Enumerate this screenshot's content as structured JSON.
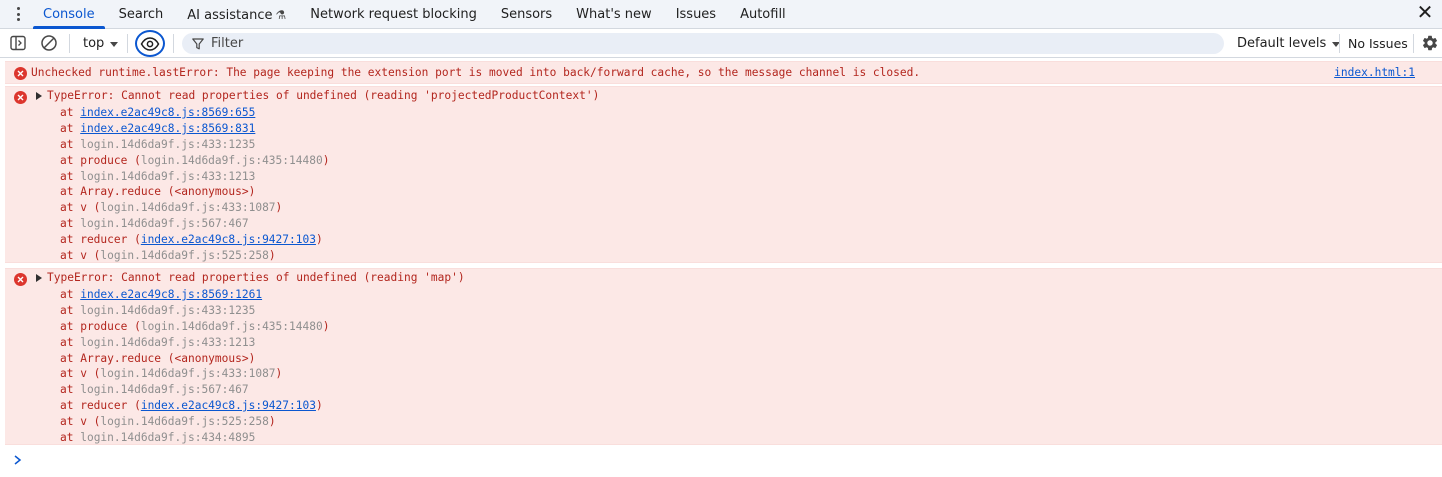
{
  "tabs": [
    {
      "label": "Console",
      "active": true
    },
    {
      "label": "Search"
    },
    {
      "label": "AI assistance",
      "icon": "flask-icon"
    },
    {
      "label": "Network request blocking"
    },
    {
      "label": "Sensors"
    },
    {
      "label": "What's new"
    },
    {
      "label": "Issues"
    },
    {
      "label": "Autofill"
    }
  ],
  "toolbar": {
    "context": "top",
    "filter_placeholder": "Filter",
    "levels": "Default levels",
    "issues": "No Issues"
  },
  "colors": {
    "accent": "#0b57d0",
    "error_bg": "#fce8e6",
    "error_text": "#b3261e",
    "error_icon": "#dc362e"
  },
  "messages": [
    {
      "text": "Unchecked runtime.lastError: The page keeping the extension port is moved into back/forward cache, so the message channel is closed.",
      "source": "index.html:1"
    },
    {
      "text": "TypeError: Cannot read properties of undefined (reading 'projectedProductContext')",
      "frames": [
        {
          "prefix": "at ",
          "link": "index.e2ac49c8.js:8569:655",
          "suffix": ""
        },
        {
          "prefix": "at ",
          "link": "index.e2ac49c8.js:8569:831",
          "suffix": ""
        },
        {
          "prefix": "at ",
          "dim": "login.14d6da9f.js:433:1235",
          "suffix": ""
        },
        {
          "prefix": "at produce (",
          "dim": "login.14d6da9f.js:435:14480",
          "suffix": ")"
        },
        {
          "prefix": "at ",
          "dim": "login.14d6da9f.js:433:1213",
          "suffix": ""
        },
        {
          "prefix": "at Array.reduce (<anonymous>)",
          "suffix": ""
        },
        {
          "prefix": "at v (",
          "dim": "login.14d6da9f.js:433:1087",
          "suffix": ")"
        },
        {
          "prefix": "at ",
          "dim": "login.14d6da9f.js:567:467",
          "suffix": ""
        },
        {
          "prefix": "at reducer (",
          "link": "index.e2ac49c8.js:9427:103",
          "suffix": ")"
        },
        {
          "prefix": "at v (",
          "dim": "login.14d6da9f.js:525:258",
          "suffix": ")"
        }
      ]
    },
    {
      "text": "TypeError: Cannot read properties of undefined (reading 'map')",
      "frames": [
        {
          "prefix": "at ",
          "link": "index.e2ac49c8.js:8569:1261",
          "suffix": ""
        },
        {
          "prefix": "at ",
          "dim": "login.14d6da9f.js:433:1235",
          "suffix": ""
        },
        {
          "prefix": "at produce (",
          "dim": "login.14d6da9f.js:435:14480",
          "suffix": ")"
        },
        {
          "prefix": "at ",
          "dim": "login.14d6da9f.js:433:1213",
          "suffix": ""
        },
        {
          "prefix": "at Array.reduce (<anonymous>)",
          "suffix": ""
        },
        {
          "prefix": "at v (",
          "dim": "login.14d6da9f.js:433:1087",
          "suffix": ")"
        },
        {
          "prefix": "at ",
          "dim": "login.14d6da9f.js:567:467",
          "suffix": ""
        },
        {
          "prefix": "at reducer (",
          "link": "index.e2ac49c8.js:9427:103",
          "suffix": ")"
        },
        {
          "prefix": "at v (",
          "dim": "login.14d6da9f.js:525:258",
          "suffix": ")"
        },
        {
          "prefix": "at ",
          "dim": "login.14d6da9f.js:434:4895",
          "suffix": ""
        }
      ]
    }
  ]
}
